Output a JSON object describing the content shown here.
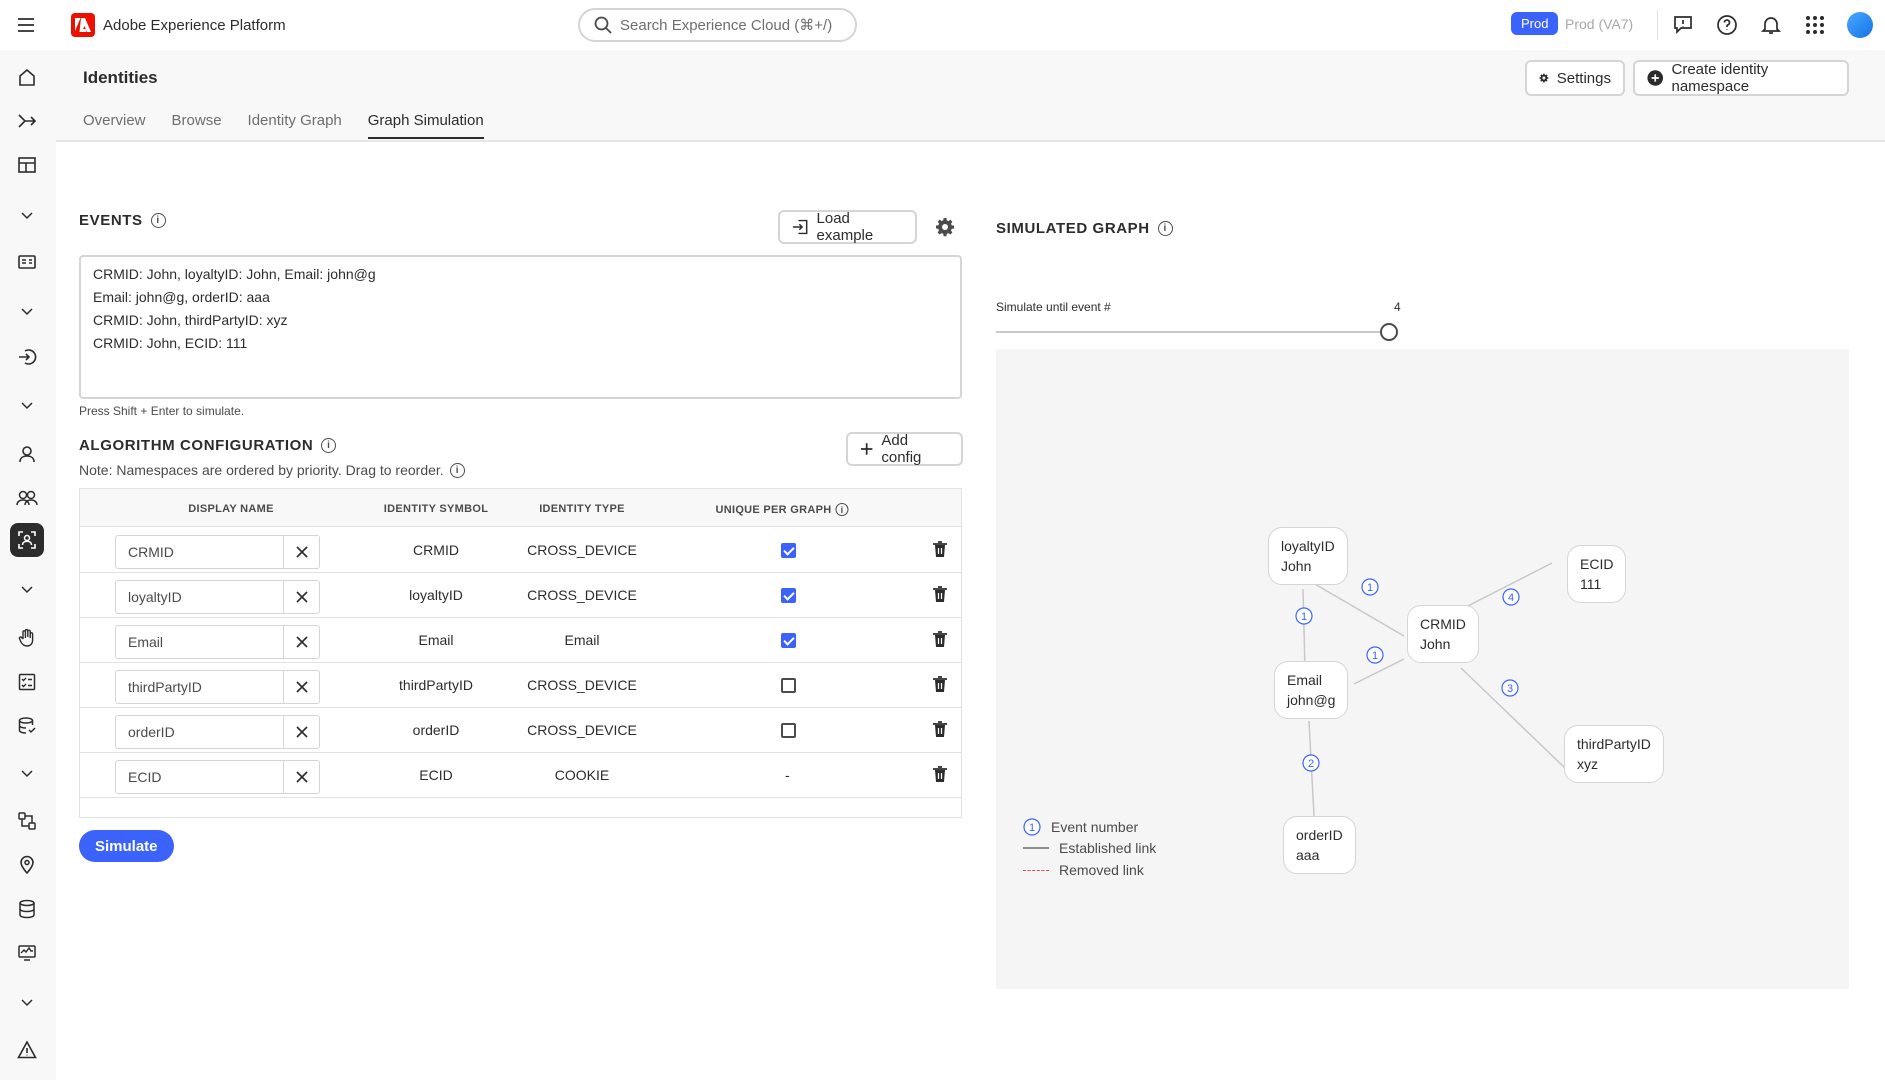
{
  "app": {
    "name": "Adobe Experience Platform",
    "search_placeholder": "Search Experience Cloud (⌘+/)",
    "env_badge": "Prod",
    "sandbox": "Prod (VA7)"
  },
  "page": {
    "title": "Identities",
    "settings_label": "Settings",
    "create_label": "Create identity namespace",
    "tabs": [
      "Overview",
      "Browse",
      "Identity Graph",
      "Graph Simulation"
    ],
    "active_tab": "Graph Simulation"
  },
  "events": {
    "heading": "EVENTS",
    "load_example_label": "Load example",
    "lines": [
      "CRMID: John, loyaltyID: John, Email: john@g",
      "Email: john@g, orderID: aaa",
      "CRMID: John, thirdPartyID: xyz",
      "CRMID: John, ECID: 111"
    ],
    "hint": "Press Shift + Enter to simulate."
  },
  "algorithm": {
    "heading": "ALGORITHM CONFIGURATION",
    "add_config_label": "Add config",
    "note": "Note: Namespaces are ordered by priority. Drag to reorder.",
    "columns": {
      "display_name": "DISPLAY NAME",
      "identity_symbol": "IDENTITY SYMBOL",
      "identity_type": "IDENTITY TYPE",
      "unique_per_graph": "UNIQUE PER GRAPH"
    },
    "rows": [
      {
        "name": "CRMID",
        "symbol": "CRMID",
        "type": "CROSS_DEVICE",
        "unique": "checked"
      },
      {
        "name": "loyaltyID",
        "symbol": "loyaltyID",
        "type": "CROSS_DEVICE",
        "unique": "checked"
      },
      {
        "name": "Email",
        "symbol": "Email",
        "type": "Email",
        "unique": "checked"
      },
      {
        "name": "thirdPartyID",
        "symbol": "thirdPartyID",
        "type": "CROSS_DEVICE",
        "unique": "unchecked"
      },
      {
        "name": "orderID",
        "symbol": "orderID",
        "type": "CROSS_DEVICE",
        "unique": "unchecked"
      },
      {
        "name": "ECID",
        "symbol": "ECID",
        "type": "COOKIE",
        "unique": "-"
      }
    ],
    "simulate_label": "Simulate"
  },
  "graph": {
    "heading": "SIMULATED GRAPH",
    "slider_label": "Simulate until event #",
    "slider_value": "4",
    "nodes": {
      "loyalty": {
        "ns": "loyaltyID",
        "id": "John"
      },
      "crmid": {
        "ns": "CRMID",
        "id": "John"
      },
      "ecid": {
        "ns": "ECID",
        "id": "111"
      },
      "email": {
        "ns": "Email",
        "id": "john@g"
      },
      "third": {
        "ns": "thirdPartyID",
        "id": "xyz"
      },
      "order": {
        "ns": "orderID",
        "id": "aaa"
      }
    },
    "edge_labels": {
      "loyalty_crmid": "1",
      "loyalty_email": "1",
      "email_crmid": "1",
      "crmid_ecid": "4",
      "crmid_third": "3",
      "email_order": "2"
    },
    "legend": {
      "event_marker": "1",
      "event_number": "Event number",
      "established": "Established link",
      "removed": "Removed link"
    },
    "colors": {
      "accent": "#3b63fb",
      "edge": "#c8c8c8",
      "removed": "#e34850"
    }
  }
}
